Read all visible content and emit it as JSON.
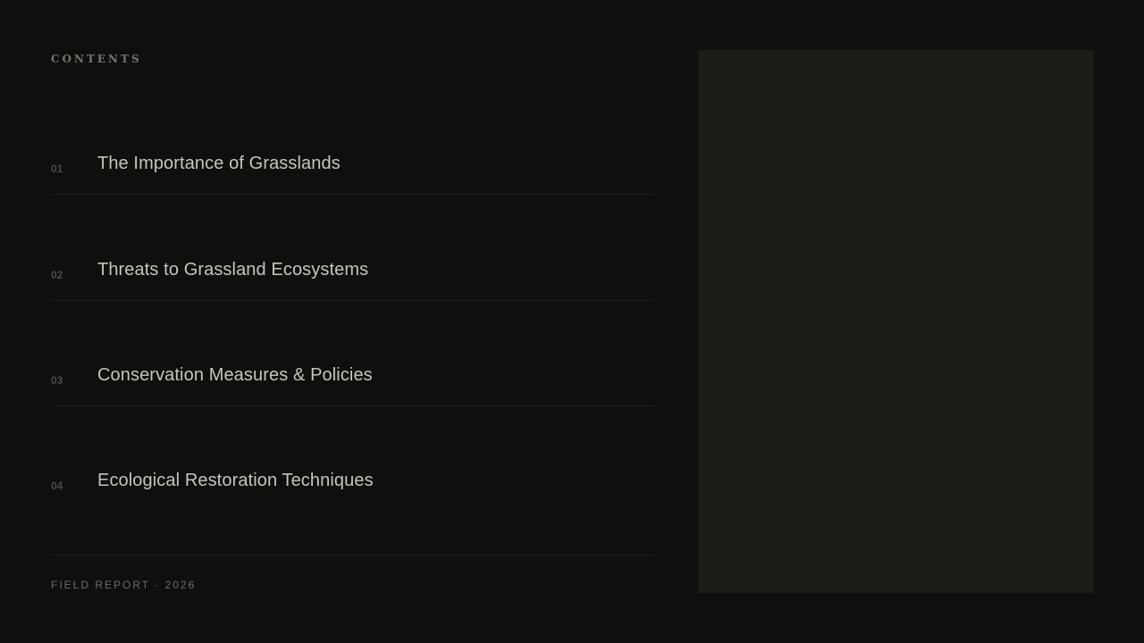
{
  "header": {
    "eyebrow": "CONTENTS"
  },
  "toc": {
    "items": [
      {
        "number": "01",
        "title": "The Importance of Grasslands"
      },
      {
        "number": "02",
        "title": "Threats to Grassland Ecosystems"
      },
      {
        "number": "03",
        "title": "Conservation Measures & Policies"
      },
      {
        "number": "04",
        "title": "Ecological Restoration Techniques"
      }
    ]
  },
  "footer": {
    "text": "FIELD REPORT · 2026"
  },
  "colors": {
    "background": "#0f0f0e",
    "panel": "#1c1c16",
    "title_text": "#c6c5ba",
    "muted_text": "#75746c",
    "divider": "#1f1f1d"
  }
}
